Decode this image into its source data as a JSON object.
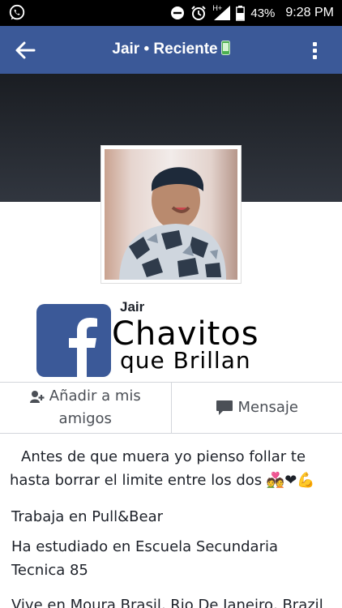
{
  "status_bar": {
    "battery": "43%",
    "time": "9:28 PM",
    "signal_label": "H+"
  },
  "app_bar": {
    "title": "Jair • Reciente"
  },
  "profile": {
    "name": "Jair",
    "brand_line1": "Chavitos",
    "brand_line2": "que Brillan"
  },
  "actions": {
    "add_friend": "Añadir a mis amigos",
    "message": "Mensaje"
  },
  "bio": "Antes de que muera yo pienso follar te hasta borrar el limite entre los dos 💑❤💪",
  "info": {
    "work": "Trabaja en Pull&Bear",
    "education": "Ha estudiado en Escuela Secundaria Tecnica 85",
    "lives": "Vive en Moura Brasil, Rio De Janeiro, Brazil"
  },
  "colors": {
    "facebook_blue": "#3b5998",
    "status_bar": "#000000"
  }
}
